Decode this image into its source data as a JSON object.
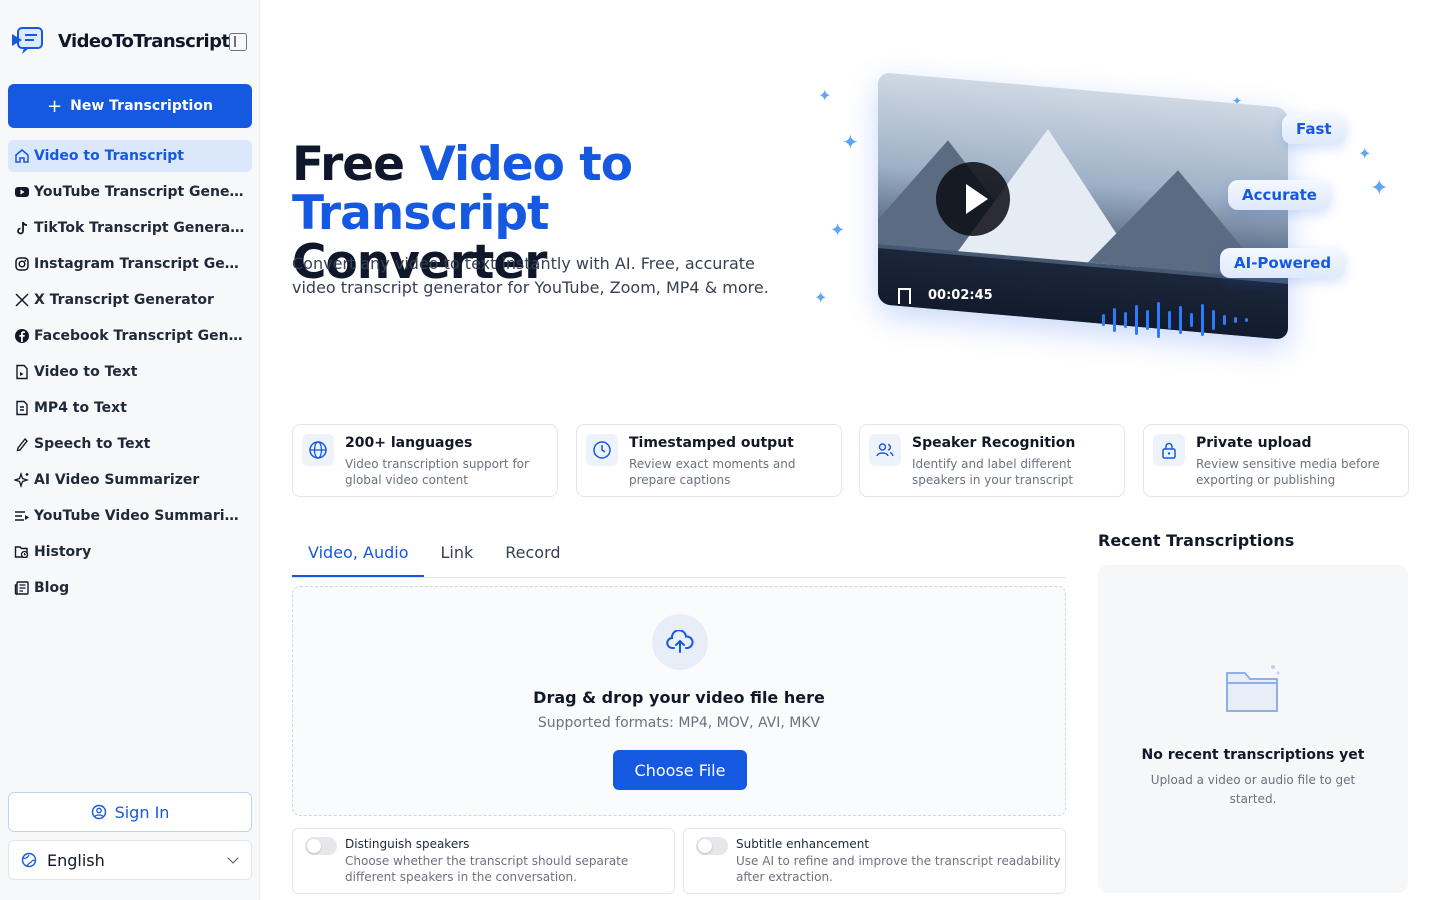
{
  "brand": {
    "name": "VideoToTranscript"
  },
  "sidebar": {
    "new_button": "New Transcription",
    "items": [
      {
        "label": "Video to Transcript",
        "icon": "home-icon",
        "active": true
      },
      {
        "label": "YouTube Transcript Generator",
        "icon": "youtube-icon"
      },
      {
        "label": "TikTok Transcript Generator",
        "icon": "tiktok-icon"
      },
      {
        "label": "Instagram Transcript Generator",
        "icon": "instagram-icon"
      },
      {
        "label": "X Transcript Generator",
        "icon": "x-icon"
      },
      {
        "label": "Facebook Transcript Generator",
        "icon": "facebook-icon"
      },
      {
        "label": "Video to Text",
        "icon": "file-video-icon"
      },
      {
        "label": "MP4 to Text",
        "icon": "file-icon"
      },
      {
        "label": "Speech to Text",
        "icon": "pen-icon"
      },
      {
        "label": "AI Video Summarizer",
        "icon": "sparkles-icon"
      },
      {
        "label": "YouTube Video Summarizer",
        "icon": "list-icon"
      },
      {
        "label": "History",
        "icon": "history-folder-icon"
      },
      {
        "label": "Blog",
        "icon": "newspaper-icon"
      }
    ],
    "sign_in": "Sign In",
    "language": "English"
  },
  "hero": {
    "title_part1": "Free ",
    "title_blue": "Video to Transcript",
    "title_part2": " Converter",
    "subtitle": "Convert any video to text instantly with AI. Free, accurate video transcript generator for YouTube, Zoom, MP4 & more.",
    "video_time": "00:02:45",
    "badges": [
      "Fast",
      "Accurate",
      "AI-Powered"
    ]
  },
  "features": [
    {
      "title": "200+ languages",
      "desc": "Video transcription support for global video content",
      "icon": "globe-icon"
    },
    {
      "title": "Timestamped output",
      "desc": "Review exact moments and prepare captions",
      "icon": "clock-icon"
    },
    {
      "title": "Speaker Recognition",
      "desc": "Identify and label different speakers in your transcript",
      "icon": "users-icon"
    },
    {
      "title": "Private upload",
      "desc": "Review sensitive media before exporting or publishing",
      "icon": "lock-icon"
    }
  ],
  "tabs": [
    "Video, Audio",
    "Link",
    "Record"
  ],
  "upload": {
    "title": "Drag & drop your video file here",
    "formats": "Supported formats: MP4, MOV, AVI, MKV",
    "button": "Choose File"
  },
  "options": [
    {
      "title": "Distinguish speakers",
      "desc": "Choose whether the transcript should separate different speakers in the conversation.",
      "enabled": false
    },
    {
      "title": "Subtitle enhancement",
      "desc": "Use AI to refine and improve the transcript readability after extraction.",
      "enabled": false
    }
  ],
  "recent": {
    "title": "Recent Transcriptions",
    "empty_title": "No recent transcriptions yet",
    "empty_hint": "Upload a video or audio file to get started."
  },
  "colors": {
    "accent": "#1559e0",
    "active_bg": "#dbe7fb"
  }
}
